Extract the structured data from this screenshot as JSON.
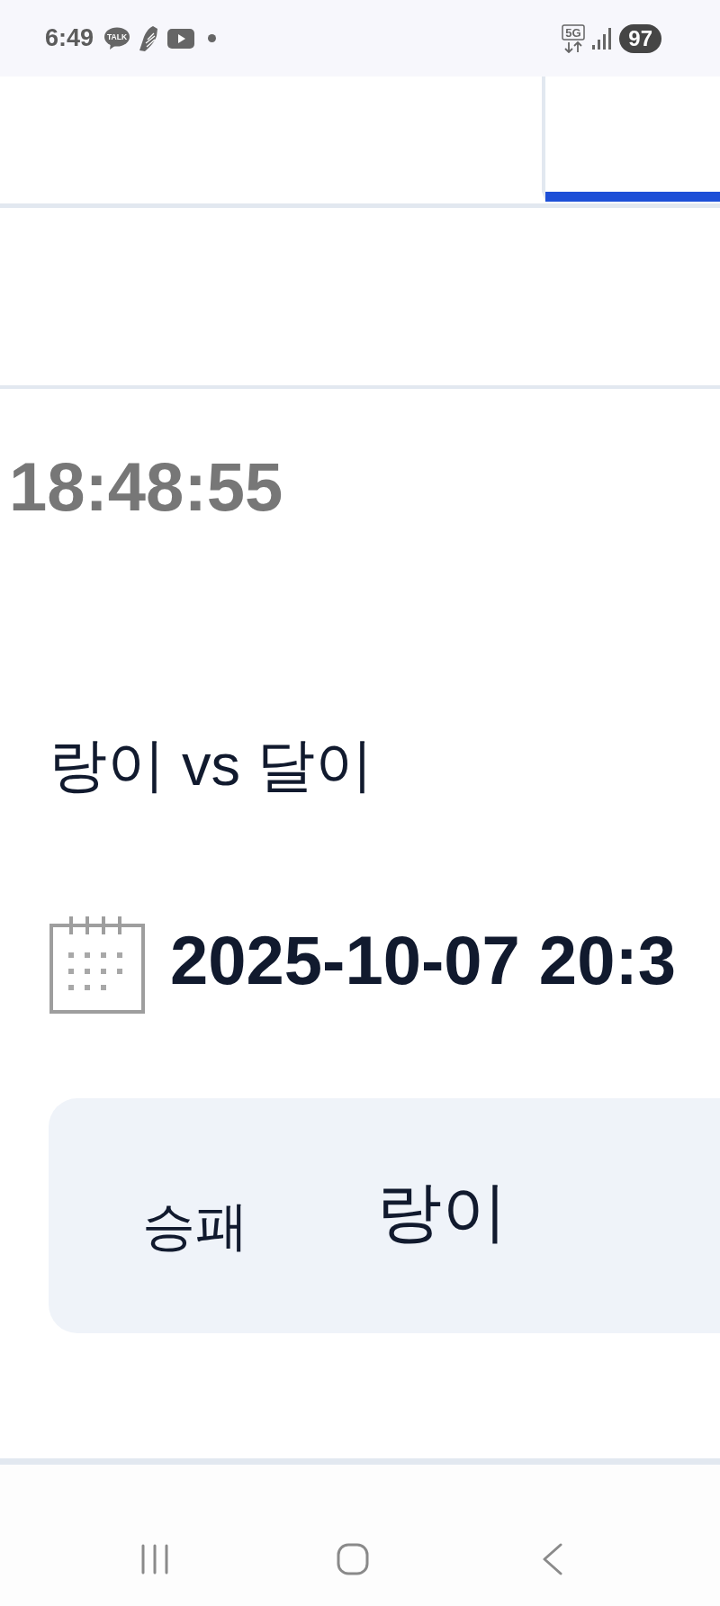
{
  "status_bar": {
    "time": "6:49",
    "notifications": [
      {
        "kind": "chat",
        "label": "TALK"
      },
      {
        "kind": "shoe"
      },
      {
        "kind": "video"
      },
      {
        "kind": "dot"
      }
    ],
    "network": "5G",
    "battery": "97"
  },
  "tabs": [
    {
      "selected": false
    },
    {
      "selected": true
    }
  ],
  "clock": "18:48:55",
  "match": {
    "title": "랑이 vs 달이",
    "datetime": "2025-10-07 20:3",
    "result_label": "승패",
    "result_value": "랑이"
  }
}
